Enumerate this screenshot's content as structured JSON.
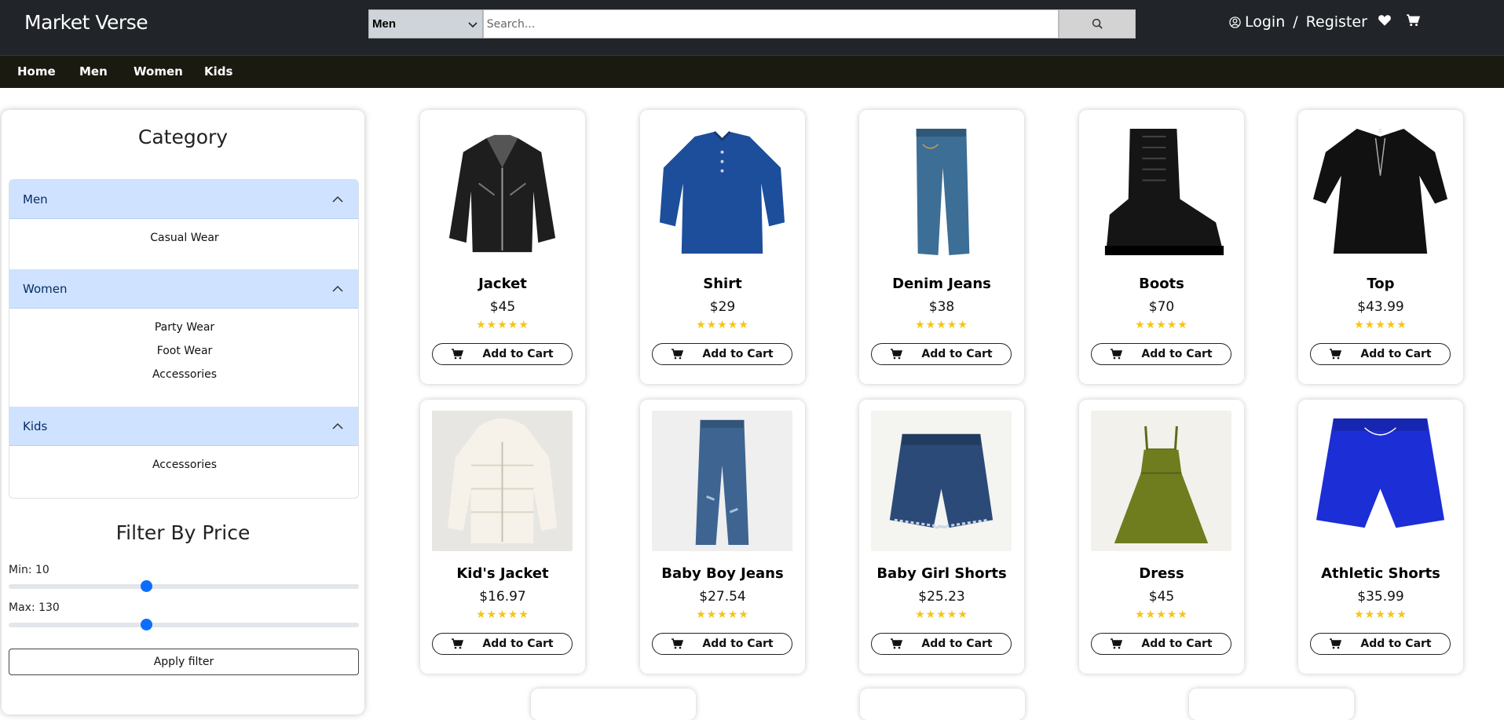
{
  "header": {
    "brand": "Market Verse",
    "category_select": "Men",
    "search_placeholder": "Search...",
    "login": "Login",
    "separator": "/",
    "register": "Register"
  },
  "nav": [
    "Home",
    "Men",
    "Women",
    "Kids"
  ],
  "sidebar": {
    "category_title": "Category",
    "groups": [
      {
        "label": "Men",
        "items": [
          "Casual Wear"
        ]
      },
      {
        "label": "Women",
        "items": [
          "Party Wear",
          "Foot Wear",
          "Accessories"
        ]
      },
      {
        "label": "Kids",
        "items": [
          "Accessories"
        ]
      }
    ],
    "filter_title": "Filter By Price",
    "min_label": "Min: 10",
    "max_label": "Max: 130",
    "min_value": 10,
    "max_value": 130,
    "apply_label": "Apply filter"
  },
  "cart_label": "Add to Cart",
  "rating_stars": "★★★★★",
  "products": [
    {
      "name": "Jacket",
      "price": "$45"
    },
    {
      "name": "Shirt",
      "price": "$29"
    },
    {
      "name": "Denim Jeans",
      "price": "$38"
    },
    {
      "name": "Boots",
      "price": "$70"
    },
    {
      "name": "Top",
      "price": "$43.99"
    },
    {
      "name": "Kid's Jacket",
      "price": "$16.97"
    },
    {
      "name": "Baby Boy Jeans",
      "price": "$27.54"
    },
    {
      "name": "Baby Girl Shorts",
      "price": "$25.23"
    },
    {
      "name": "Dress",
      "price": "$45"
    },
    {
      "name": "Athletic Shorts",
      "price": "$35.99"
    }
  ],
  "colors": {
    "header_bg": "#212529",
    "nav_bg": "#1b1a10",
    "accordion_header": "#cfe2ff",
    "slider_thumb": "#0d6efd",
    "star": "#f5c518"
  }
}
